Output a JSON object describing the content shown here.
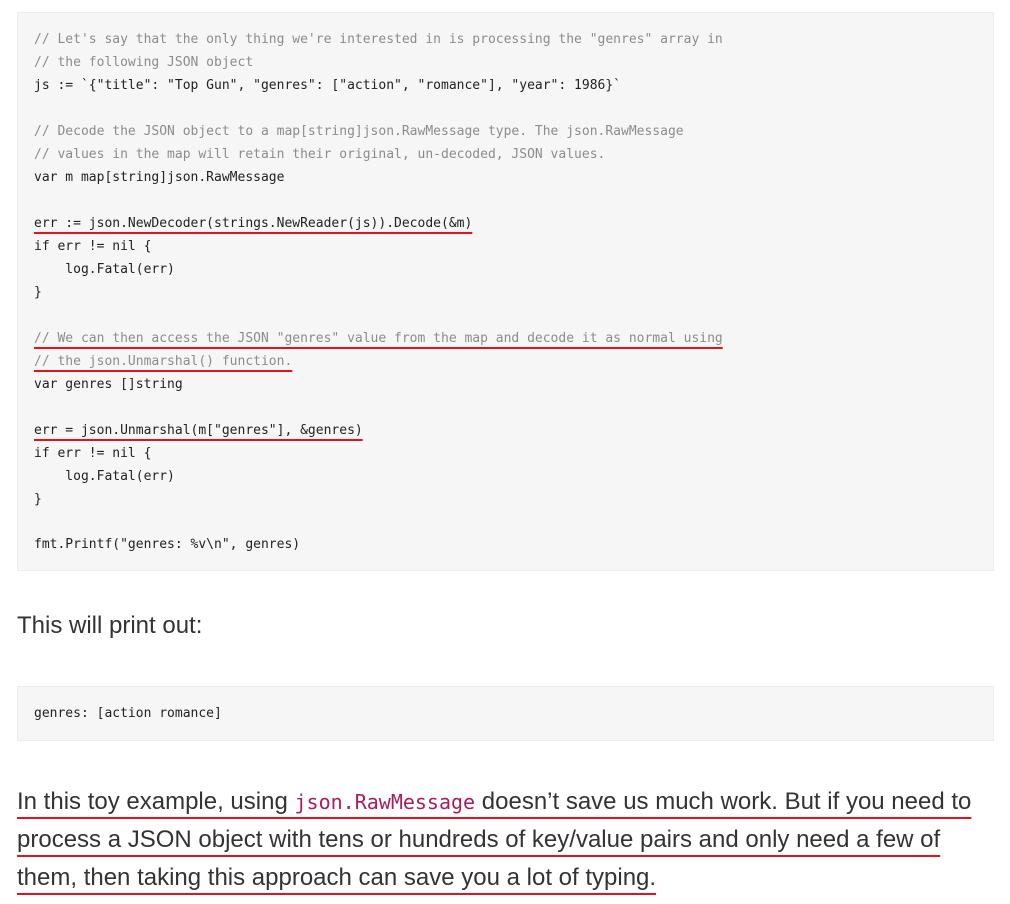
{
  "code_block": {
    "lines": [
      "// Let's say that the only thing we're interested in is processing the \"genres\" array in",
      "// the following JSON object",
      "js := `{\"title\": \"Top Gun\", \"genres\": [\"action\", \"romance\"], \"year\": 1986}`",
      "",
      "// Decode the JSON object to a map[string]json.RawMessage type. The json.RawMessage",
      "// values in the map will retain their original, un-decoded, JSON values.",
      "var m map[string]json.RawMessage",
      "",
      "err := json.NewDecoder(strings.NewReader(js)).Decode(&m)",
      "if err != nil {",
      "    log.Fatal(err)",
      "}",
      "",
      "// We can then access the JSON \"genres\" value from the map and decode it as normal using",
      "// the json.Unmarshal() function.",
      "var genres []string",
      "",
      "err = json.Unmarshal(m[\"genres\"], &genres)",
      "if err != nil {",
      "    log.Fatal(err)",
      "}",
      "",
      "fmt.Printf(\"genres: %v\\n\", genres)"
    ]
  },
  "output_intro": "This will print out:",
  "output_block": "genres: [action romance]",
  "paragraph": {
    "part1": "In this toy example, using ",
    "code": "json.RawMessage",
    "part2": " doesn’t save us much work. But if you need to process a JSON object with tens or hundreds of key/value pairs and only need a few of them, then taking this approach can save you a lot of typing."
  },
  "colors": {
    "keyword": "#a71d5d",
    "comment": "#8c8c8c",
    "string": "#1d6a9e",
    "annotation_underline": "#e0151b"
  }
}
